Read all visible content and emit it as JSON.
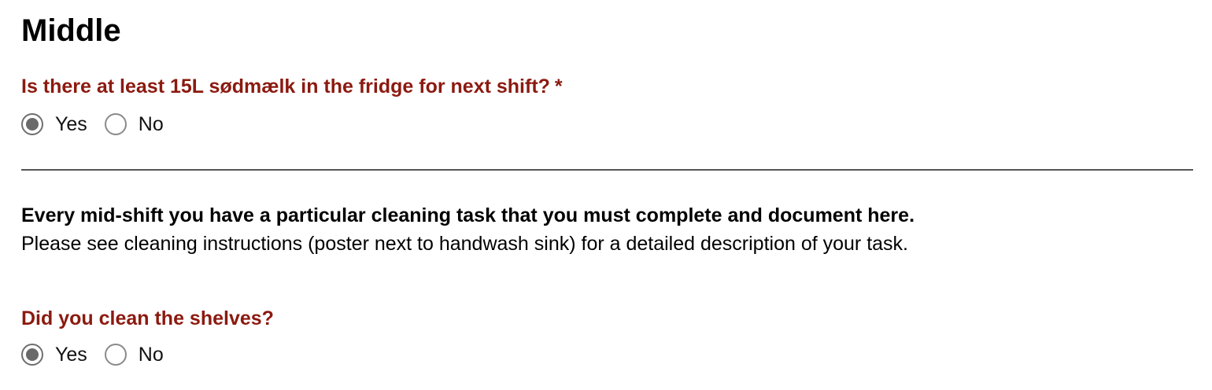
{
  "section": {
    "title": "Middle"
  },
  "questions": [
    {
      "label": "Is there at least 15L sødmælk in the fridge for next shift?",
      "required_marker": "*",
      "options": [
        "Yes",
        "No"
      ],
      "selected": "Yes"
    },
    {
      "label": "Did you clean the shelves?",
      "options": [
        "Yes",
        "No"
      ],
      "selected": "Yes"
    }
  ],
  "note": {
    "bold": "Every mid-shift you have a particular cleaning task that you must complete and document here.",
    "normal": "Please see cleaning instructions (poster next to handwash sink) for a detailed description of your task."
  },
  "colors": {
    "question_text": "#8b1a10",
    "divider": "#555555",
    "radio_border": "#8a8a8a",
    "radio_dot": "#6a6a6a"
  }
}
